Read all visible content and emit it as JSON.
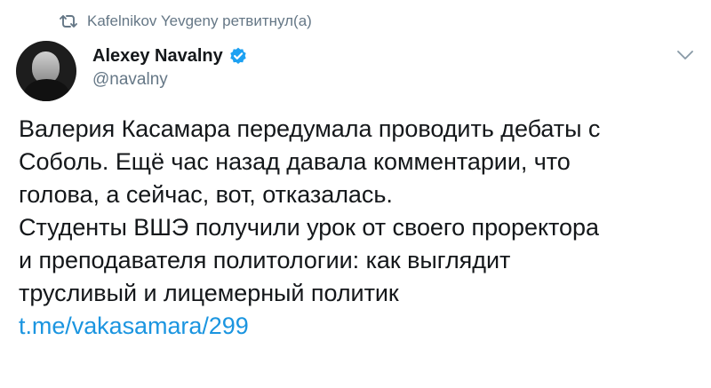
{
  "retweet": {
    "icon": "retweet-icon",
    "text": "Kafelnikov Yevgeny ретвитнул(а)"
  },
  "author": {
    "avatar": "avatar-image",
    "name": "Alexey Navalny",
    "verified_icon": "verified-badge-icon",
    "handle": "@navalny"
  },
  "menu": {
    "icon": "chevron-down-icon"
  },
  "tweet": {
    "lines": [
      "Валерия Касамара передумала проводить дебаты с",
      "Соболь. Ещё час назад давала комментарии, что",
      "голова, а сейчас, вот, отказалась.",
      "Студенты ВШЭ получили урок от своего проректора",
      "и преподавателя политологии: как выглядит",
      "трусливый и лицемерный политик"
    ],
    "link": "t.me/vakasamara/299"
  },
  "colors": {
    "text": "#14171a",
    "secondary": "#657786",
    "link": "#1b95e0",
    "verified": "#1da1f2"
  }
}
